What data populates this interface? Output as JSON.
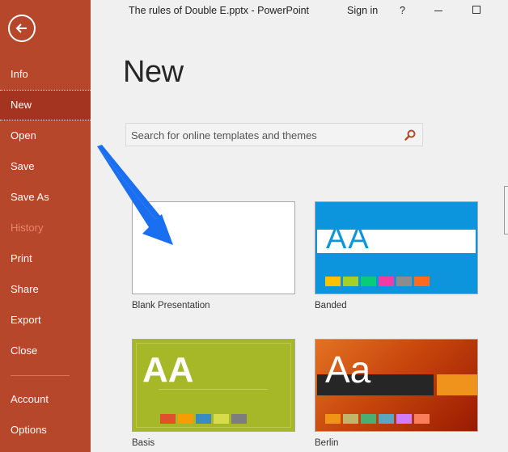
{
  "window": {
    "title": "The rules of Double E.pptx  -  PowerPoint",
    "sign_in": "Sign in",
    "help": "?"
  },
  "sidebar": {
    "back_label": "Back",
    "items": [
      {
        "label": "Info",
        "state": "normal"
      },
      {
        "label": "New",
        "state": "selected"
      },
      {
        "label": "Open",
        "state": "normal"
      },
      {
        "label": "Save",
        "state": "normal"
      },
      {
        "label": "Save As",
        "state": "normal"
      },
      {
        "label": "History",
        "state": "disabled"
      },
      {
        "label": "Print",
        "state": "normal"
      },
      {
        "label": "Share",
        "state": "normal"
      },
      {
        "label": "Export",
        "state": "normal"
      },
      {
        "label": "Close",
        "state": "normal"
      },
      {
        "label": "Account",
        "state": "normal"
      },
      {
        "label": "Options",
        "state": "normal"
      }
    ]
  },
  "main": {
    "page_title": "New",
    "search": {
      "placeholder": "Search for online templates and themes",
      "value": ""
    },
    "templates": [
      {
        "name": "Blank Presentation",
        "sample": ""
      },
      {
        "name": "Banded",
        "sample": "AA",
        "swatches": [
          "#ffc000",
          "#a5d028",
          "#08cc78",
          "#f23ba4",
          "#8c8c8c",
          "#ff6a1f"
        ]
      },
      {
        "name": "Basis",
        "sample": "AA",
        "swatches": [
          "#e0502a",
          "#f79d00",
          "#3a8cc0",
          "#d7dc4b",
          "#7d7d7d"
        ]
      },
      {
        "name": "Berlin",
        "sample": "Aa",
        "swatches": [
          "#f09415",
          "#c1b56b",
          "#4baf73",
          "#5aa6c0",
          "#d17df9",
          "#fa7e5c"
        ]
      }
    ]
  },
  "colors": {
    "sidebar": "#b7472a",
    "sidebar_selected": "#a4331f",
    "annotation_arrow": "#1a6ff0"
  }
}
